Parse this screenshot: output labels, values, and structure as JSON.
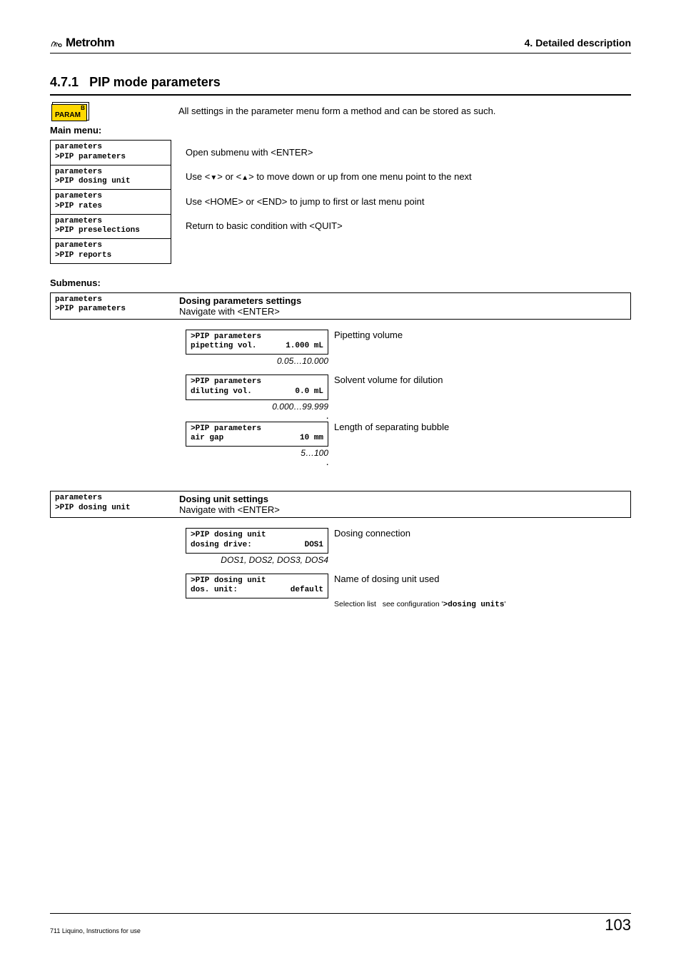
{
  "header": {
    "logo_text": "Metrohm",
    "chapter": "4. Detailed description"
  },
  "section": {
    "number": "4.7.1",
    "title": "PIP mode parameters"
  },
  "param_key": {
    "label": "PARAM",
    "corner": "B"
  },
  "intro_text": "All settings in the parameter menu form a method and can be stored as such.",
  "main_menu_label": "Main menu:",
  "main_menu": [
    {
      "l1": "parameters",
      "l2": ">PIP parameters",
      "desc": "Open submenu with <ENTER>"
    },
    {
      "l1": "parameters",
      "l2": ">PIP dosing unit",
      "desc_pre": "Use <",
      "desc_mid": "> or <",
      "desc_post": "> to move down or up from one menu point to the next"
    },
    {
      "l1": "parameters",
      "l2": ">PIP rates",
      "desc": "Use <HOME> or <END> to jump to first or last menu point"
    },
    {
      "l1": "parameters",
      "l2": ">PIP preselections",
      "desc": "Return to basic condition with <QUIT>"
    },
    {
      "l1": "parameters",
      "l2": ">PIP reports",
      "desc": ""
    }
  ],
  "submenus_label": "Submenus:",
  "sub1": {
    "left_l1": "parameters",
    "left_l2": ">PIP parameters",
    "title": "Dosing parameters settings",
    "nav": "Navigate with <ENTER>",
    "items": [
      {
        "l1": ">PIP parameters",
        "l2a": "pipetting vol.",
        "l2b": "1.000 mL",
        "range": "0.05…10.000",
        "desc": "Pipetting volume"
      },
      {
        "l1": ">PIP parameters",
        "l2a": "diluting vol.",
        "l2b": "0.0 mL",
        "range": "0.000…99.999",
        "desc": "Solvent volume for dilution"
      },
      {
        "l1": ">PIP parameters",
        "l2a": "air gap",
        "l2b": "10 mm",
        "range": "5…100",
        "desc": "Length of separating bubble"
      }
    ]
  },
  "sub2": {
    "left_l1": "parameters",
    "left_l2": ">PIP dosing unit",
    "title": "Dosing unit settings",
    "nav": "Navigate with <ENTER>",
    "items": [
      {
        "l1": ">PIP dosing unit",
        "l2a": "dosing drive:",
        "l2b": "DOS1",
        "range": "DOS1, DOS2, DOS3, DOS4",
        "desc": "Dosing connection"
      },
      {
        "l1": ">PIP dosing unit",
        "l2a": "dos. unit:",
        "l2b": "default",
        "desc": "Name of dosing unit used",
        "sel_label": "Selection list",
        "sel_text_pre": "see configuration '",
        "sel_cfg": ">dosing units",
        "sel_text_post": "'"
      }
    ]
  },
  "footer": {
    "left": "711 Liquino, Instructions for use",
    "page": "103"
  }
}
